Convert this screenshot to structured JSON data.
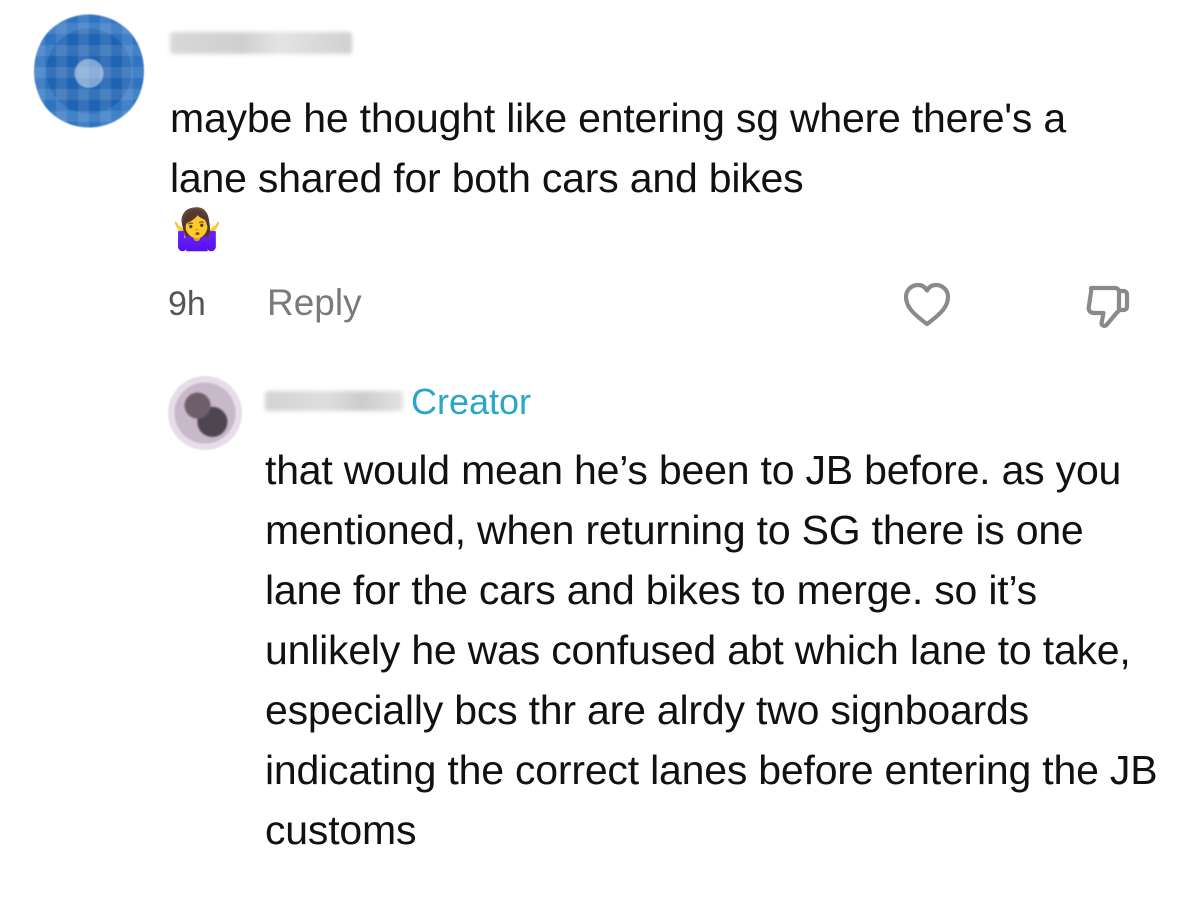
{
  "comments": [
    {
      "avatar_icon": "user-avatar-icon",
      "text": "maybe he thought like entering sg where there's a lane shared for both cars and bikes",
      "emoji": "🤷‍♀️",
      "time": "9h",
      "reply_label": "Reply",
      "like_icon": "heart-icon",
      "dislike_icon": "thumbs-down-icon"
    }
  ],
  "reply": {
    "avatar_icon": "creator-avatar-icon",
    "badge": "Creator",
    "badge_color": "#2aa6c6",
    "text": "that would mean he’s been to JB before. as you mentioned, when returning to SG there is one lane for the cars and bikes to merge. so it’s unlikely he was confused abt which lane to take, especially bcs thr are alrdy two signboards indicating the correct lanes before entering the JB customs"
  }
}
